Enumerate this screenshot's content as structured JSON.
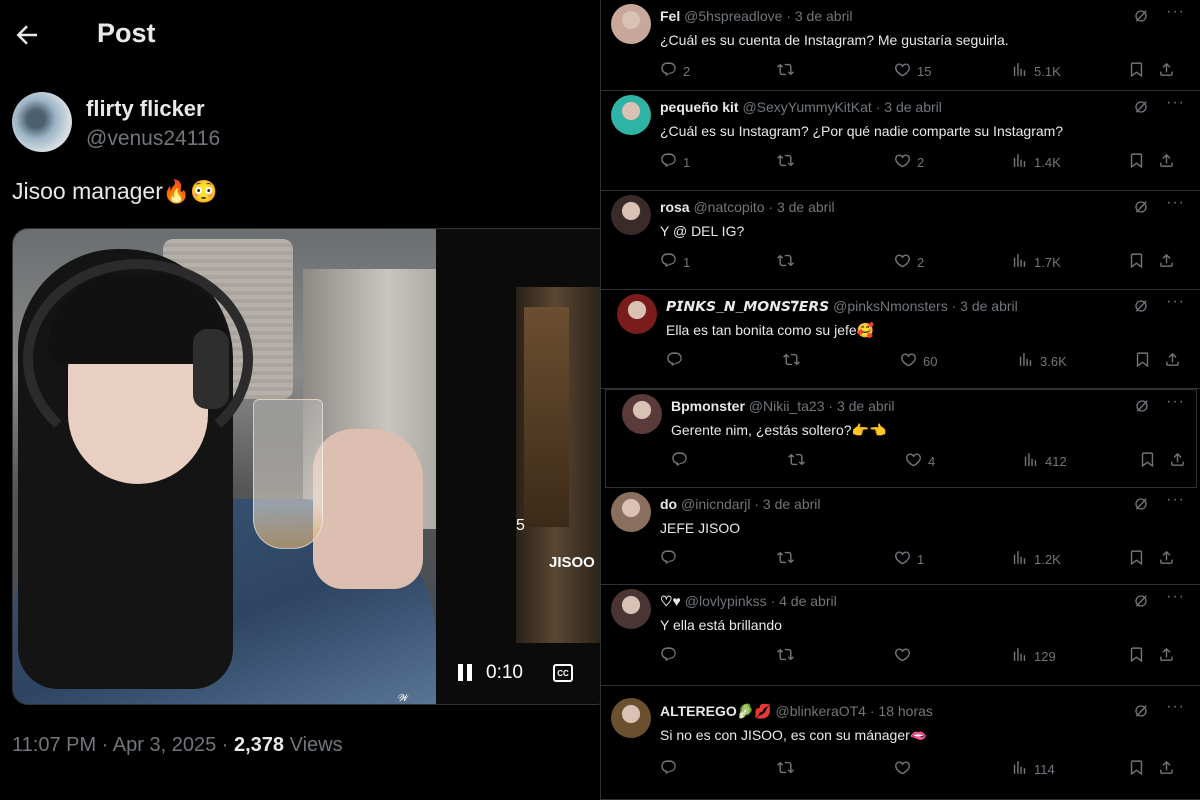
{
  "header": {
    "title": "Post"
  },
  "post": {
    "author_name": "flirty flicker",
    "author_handle": "@venus24116",
    "text": "Jisoo manager",
    "text_emojis": "🔥😳",
    "video_elapsed": "0:10",
    "video_overlay_text": "JISOO",
    "video_overlay_number": "5",
    "watermark": "𝓦",
    "timestamp": "11:07 PM · Apr 3, 2025 · ",
    "views_count": "2,378",
    "views_label": " Views"
  },
  "replies": [
    {
      "name": "Fel",
      "handle": "@5hspreadlove",
      "date": "3 de abril",
      "text": "¿Cuál es su cuenta de Instagram? Me gustaría seguirla.",
      "replies": "2",
      "reposts": "",
      "likes": "15",
      "views": "5.1K",
      "avatar_color": "#c8a89a"
    },
    {
      "name": "pequeño kit",
      "handle": "@SexyYummyKitKat",
      "date": "3 de abril",
      "text": "¿Cuál es su Instagram? ¿Por qué nadie comparte su Instagram?",
      "replies": "1",
      "reposts": "",
      "likes": "2",
      "views": "1.4K",
      "avatar_color": "#2fb3a4"
    },
    {
      "name": "rosa",
      "handle": "@natcopito",
      "date": "3 de abril",
      "text": "Y @ DEL IG?",
      "replies": "1",
      "reposts": "",
      "likes": "2",
      "views": "1.7K",
      "avatar_color": "#3a2a2a"
    },
    {
      "name": "𝙋𝙄𝙉𝙆𝙎_𝙉_𝙈𝙊𝙉𝙎𝟕𝙀𝙍𝙎",
      "handle": "@pinksNmonsters",
      "date": "3 de abril",
      "text": "Ella es tan bonita como su jefe🥰",
      "replies": "",
      "reposts": "",
      "likes": "60",
      "views": "3.6K",
      "avatar_color": "#7a1c1c"
    },
    {
      "name": "Bpmonster",
      "handle": "@Nikii_ta23",
      "date": "3 de abril",
      "text": "Gerente nim, ¿estás soltero?👉👈",
      "replies": "",
      "reposts": "",
      "likes": "4",
      "views": "412",
      "avatar_color": "#5a3a3a"
    },
    {
      "name": "do",
      "handle": "@inicndarjl",
      "date": "3 de abril",
      "text": "JEFE JISOO",
      "replies": "",
      "reposts": "",
      "likes": "1",
      "views": "1.2K",
      "avatar_color": "#8a6e5e"
    },
    {
      "name": "♡♥",
      "handle": "@lovlypinkss",
      "date": "4 de abril",
      "text": "Y ella está brillando",
      "replies": "",
      "reposts": "",
      "likes": "",
      "views": "129",
      "avatar_color": "#4a3434"
    },
    {
      "name": "ALTEREGO🥬💋",
      "handle": "@blinkeraOT4",
      "date": "18 horas",
      "text": "Si no es con JISOO, es con su mánager🫦",
      "replies": "",
      "reposts": "",
      "likes": "",
      "views": "114",
      "avatar_color": "#6b5030"
    }
  ],
  "separator": "·",
  "more_label": "···",
  "icons": [
    "back-arrow-icon",
    "pause-icon",
    "cc-icon",
    "grok-icon",
    "more-icon",
    "reply-icon",
    "repost-icon",
    "like-icon",
    "views-icon",
    "bookmark-icon",
    "share-icon"
  ]
}
